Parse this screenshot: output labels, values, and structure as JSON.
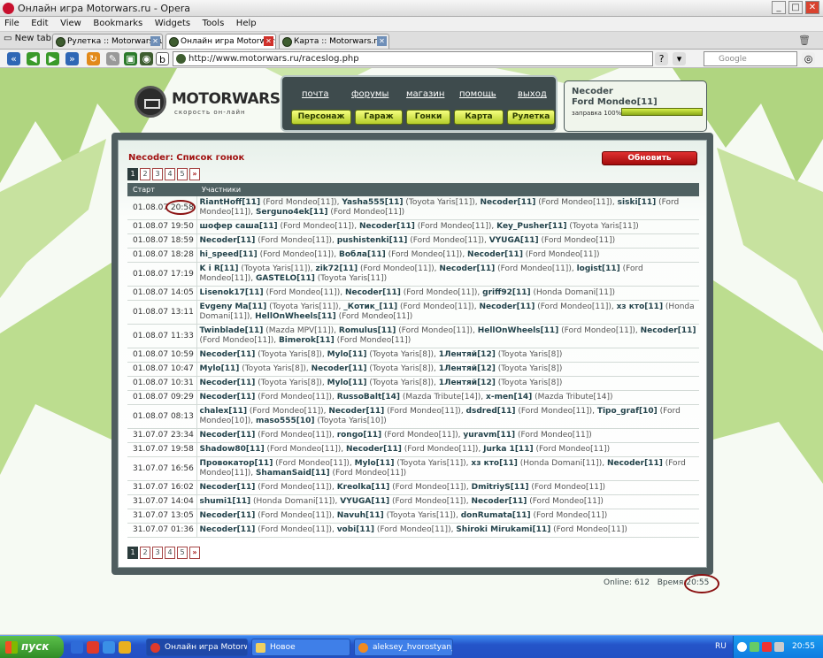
{
  "window": {
    "title": "Онлайн игра Motorwars.ru - Opera",
    "min": "_",
    "max": "□",
    "close": "✕"
  },
  "menu": [
    "File",
    "Edit",
    "View",
    "Bookmarks",
    "Widgets",
    "Tools",
    "Help"
  ],
  "tabs": {
    "new_tab": "New tab",
    "items": [
      "Рулетка :: Motorwars.ru",
      "Онлайн игра Motorwars.ru",
      "Карта :: Motorwars.ru"
    ],
    "active_index": 1
  },
  "address": {
    "url": "http://www.motorwars.ru/raceslog.php",
    "search_placeholder": "Google",
    "help": "?"
  },
  "site": {
    "brand": "MOTORWARS.RU",
    "slogan": "скорость он-лайн",
    "top_links": [
      "почта",
      "форумы",
      "магазин",
      "помощь",
      "выход"
    ],
    "buttons": [
      "Персонаж",
      "Гараж",
      "Гонки",
      "Карта",
      "Рулетка"
    ],
    "user": {
      "name": "Necoder",
      "car": "Ford Mondeo[11]",
      "fuel_label": "заправка 100%",
      "fuel": 1.0
    }
  },
  "panel": {
    "title": "Necoder: Список гонок",
    "refresh": "Обновить",
    "pages": [
      "1",
      "2",
      "3",
      "4",
      "5",
      "»"
    ],
    "current_page": "1",
    "headers": [
      "Старт",
      "Участники"
    ],
    "rows": [
      {
        "t": "01.08.07 20:58",
        "p": [
          [
            "RiantHoff[11]",
            " (Ford Mondeo[11]), "
          ],
          [
            "Yasha555[11]",
            " (Toyota Yaris[11]), "
          ],
          [
            "Necoder[11]",
            " (Ford Mondeo[11]), "
          ],
          [
            "siski[11]",
            " (Ford Mondeo[11]), "
          ],
          [
            "Serguno4ek[11]",
            " (Ford Mondeo[11])"
          ]
        ]
      },
      {
        "t": "01.08.07 19:50",
        "p": [
          [
            "шофер саша[11]",
            " (Ford Mondeo[11]), "
          ],
          [
            "Necoder[11]",
            " (Ford Mondeo[11]), "
          ],
          [
            "Key_Pusher[11]",
            " (Toyota Yaris[11])"
          ]
        ]
      },
      {
        "t": "01.08.07 18:59",
        "p": [
          [
            "Necoder[11]",
            " (Ford Mondeo[11]), "
          ],
          [
            "pushistenki[11]",
            " (Ford Mondeo[11]), "
          ],
          [
            "VYUGA[11]",
            " (Ford Mondeo[11])"
          ]
        ]
      },
      {
        "t": "01.08.07 18:28",
        "p": [
          [
            "hi_speed[11]",
            " (Ford Mondeo[11]), "
          ],
          [
            "Вобла[11]",
            " (Ford Mondeo[11]), "
          ],
          [
            "Necoder[11]",
            " (Ford Mondeo[11])"
          ]
        ]
      },
      {
        "t": "01.08.07 17:19",
        "p": [
          [
            "K i R[11]",
            " (Toyota Yaris[11]), "
          ],
          [
            "zik72[11]",
            " (Ford Mondeo[11]), "
          ],
          [
            "Necoder[11]",
            " (Ford Mondeo[11]), "
          ],
          [
            "logist[11]",
            " (Ford Mondeo[11]), "
          ],
          [
            "GASTELO[11]",
            " (Toyota Yaris[11])"
          ]
        ]
      },
      {
        "t": "01.08.07 14:05",
        "p": [
          [
            "Lisenok17[11]",
            " (Ford Mondeo[11]), "
          ],
          [
            "Necoder[11]",
            " (Ford Mondeo[11]), "
          ],
          [
            "griff92[11]",
            " (Honda Domani[11])"
          ]
        ]
      },
      {
        "t": "01.08.07 13:11",
        "p": [
          [
            "Evgeny Ma[11]",
            " (Toyota Yaris[11]), "
          ],
          [
            "_Котик_[11]",
            " (Ford Mondeo[11]), "
          ],
          [
            "Necoder[11]",
            " (Ford Mondeo[11]), "
          ],
          [
            "хз кто[11]",
            " (Honda Domani[11]), "
          ],
          [
            "HellOnWheels[11]",
            " (Ford Mondeo[11])"
          ]
        ]
      },
      {
        "t": "01.08.07 11:33",
        "p": [
          [
            "Twinblade[11]",
            " (Mazda MPV[11]), "
          ],
          [
            "Romulus[11]",
            " (Ford Mondeo[11]), "
          ],
          [
            "HellOnWheels[11]",
            " (Ford Mondeo[11]), "
          ],
          [
            "Necoder[11]",
            " (Ford Mondeo[11]), "
          ],
          [
            "Bimerok[11]",
            " (Ford Mondeo[11])"
          ]
        ]
      },
      {
        "t": "01.08.07 10:59",
        "p": [
          [
            "Necoder[11]",
            " (Toyota Yaris[8]), "
          ],
          [
            "Mylo[11]",
            " (Toyota Yaris[8]), "
          ],
          [
            "1Лентяй[12]",
            " (Toyota Yaris[8])"
          ]
        ]
      },
      {
        "t": "01.08.07 10:47",
        "p": [
          [
            "Mylo[11]",
            " (Toyota Yaris[8]), "
          ],
          [
            "Necoder[11]",
            " (Toyota Yaris[8]), "
          ],
          [
            "1Лентяй[12]",
            " (Toyota Yaris[8])"
          ]
        ]
      },
      {
        "t": "01.08.07 10:31",
        "p": [
          [
            "Necoder[11]",
            " (Toyota Yaris[8]), "
          ],
          [
            "Mylo[11]",
            " (Toyota Yaris[8]), "
          ],
          [
            "1Лентяй[12]",
            " (Toyota Yaris[8])"
          ]
        ]
      },
      {
        "t": "01.08.07 09:29",
        "p": [
          [
            "Necoder[11]",
            " (Ford Mondeo[11]), "
          ],
          [
            "RussoBalt[14]",
            " (Mazda Tribute[14]), "
          ],
          [
            "x-men[14]",
            " (Mazda Tribute[14])"
          ]
        ]
      },
      {
        "t": "01.08.07 08:13",
        "p": [
          [
            "chalex[11]",
            " (Ford Mondeo[11]), "
          ],
          [
            "Necoder[11]",
            " (Ford Mondeo[11]), "
          ],
          [
            "dsdred[11]",
            " (Ford Mondeo[11]), "
          ],
          [
            "Tipo_graf[10]",
            " (Ford Mondeo[10]), "
          ],
          [
            "maso555[10]",
            " (Toyota Yaris[10])"
          ]
        ]
      },
      {
        "t": "31.07.07 23:34",
        "p": [
          [
            "Necoder[11]",
            " (Ford Mondeo[11]), "
          ],
          [
            "rongo[11]",
            " (Ford Mondeo[11]), "
          ],
          [
            "yuravm[11]",
            " (Ford Mondeo[11])"
          ]
        ]
      },
      {
        "t": "31.07.07 19:58",
        "p": [
          [
            "Shadow80[11]",
            " (Ford Mondeo[11]), "
          ],
          [
            "Necoder[11]",
            " (Ford Mondeo[11]), "
          ],
          [
            "Jurka 1[11]",
            " (Ford Mondeo[11])"
          ]
        ]
      },
      {
        "t": "31.07.07 16:56",
        "p": [
          [
            "Провокатор[11]",
            " (Ford Mondeo[11]), "
          ],
          [
            "Mylo[11]",
            " (Toyota Yaris[11]), "
          ],
          [
            "хз кто[11]",
            " (Honda Domani[11]), "
          ],
          [
            "Necoder[11]",
            " (Ford Mondeo[11]), "
          ],
          [
            "ShamanSaid[11]",
            " (Ford Mondeo[11])"
          ]
        ]
      },
      {
        "t": "31.07.07 16:02",
        "p": [
          [
            "Necoder[11]",
            " (Ford Mondeo[11]), "
          ],
          [
            "Kreolka[11]",
            " (Ford Mondeo[11]), "
          ],
          [
            "DmitriyS[11]",
            " (Ford Mondeo[11])"
          ]
        ]
      },
      {
        "t": "31.07.07 14:04",
        "p": [
          [
            "shumi1[11]",
            " (Honda Domani[11]), "
          ],
          [
            "VYUGA[11]",
            " (Ford Mondeo[11]), "
          ],
          [
            "Necoder[11]",
            " (Ford Mondeo[11])"
          ]
        ]
      },
      {
        "t": "31.07.07 13:05",
        "p": [
          [
            "Necoder[11]",
            " (Ford Mondeo[11]), "
          ],
          [
            "Navuh[11]",
            " (Toyota Yaris[11]), "
          ],
          [
            "donRumata[11]",
            " (Ford Mondeo[11])"
          ]
        ]
      },
      {
        "t": "31.07.07 01:36",
        "p": [
          [
            "Necoder[11]",
            " (Ford Mondeo[11]), "
          ],
          [
            "vobi[11]",
            " (Ford Mondeo[11]), "
          ],
          [
            "Shiroki Mirukami[11]",
            " (Ford Mondeo[11])"
          ]
        ]
      }
    ],
    "tall_rows": [
      0,
      4,
      6,
      7,
      12,
      15
    ]
  },
  "footer": {
    "online_label": "Online:",
    "online": "612",
    "time_label": "Время:",
    "time": "20:55"
  },
  "taskbar": {
    "start": "пуск",
    "tasks": [
      "Онлайн игра Motorw...",
      "Новое",
      "aleksey_hvorostyan_..."
    ],
    "lang": "RU",
    "clock": "20:55"
  }
}
